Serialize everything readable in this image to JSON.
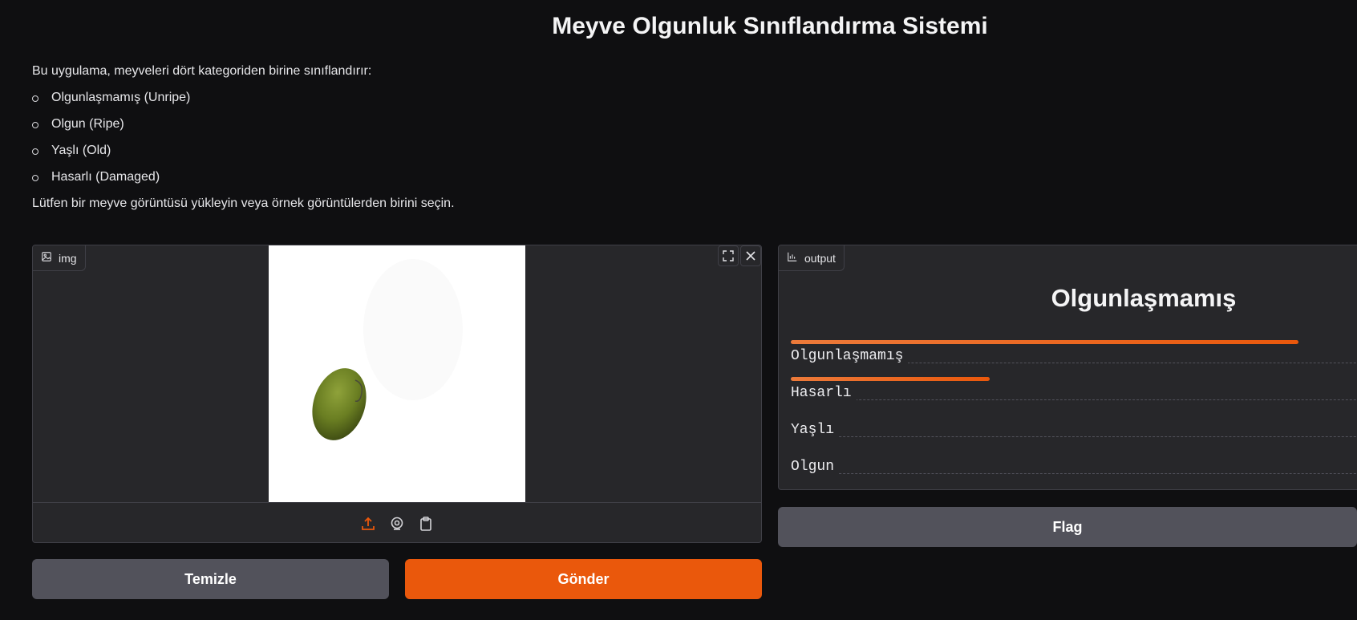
{
  "header": {
    "title": "Meyve Olgunluk Sınıflandırma Sistemi"
  },
  "description": {
    "intro": "Bu uygulama, meyveleri dört kategoriden birine sınıflandırır:",
    "items": [
      "Olgunlaşmamış (Unripe)",
      "Olgun (Ripe)",
      "Yaşlı (Old)",
      "Hasarlı (Damaged)"
    ],
    "note": "Lütfen bir meyve görüntüsü yükleyin veya örnek görüntülerden birini seçin."
  },
  "input_panel": {
    "label": "img",
    "icons": {
      "label": "image-icon",
      "fullscreen": "fullscreen-icon",
      "clear": "close-icon",
      "upload": "upload-icon",
      "webcam": "webcam-icon",
      "clipboard": "clipboard-icon"
    }
  },
  "output_panel": {
    "label": "output",
    "top_label": "Olgunlaşmamış",
    "confidences": [
      {
        "label": "Olgunlaşmamış",
        "value": 0.74
      },
      {
        "label": "Hasarlı",
        "value": 0.29
      },
      {
        "label": "Yaşlı",
        "value": 0.0
      },
      {
        "label": "Olgun",
        "value": 0.0
      }
    ]
  },
  "buttons": {
    "clear": "Temizle",
    "submit": "Gönder",
    "flag": "Flag"
  },
  "colors": {
    "background": "#0f0f11",
    "panel": "#27272a",
    "accent": "#ea580c",
    "secondary_button": "#52525b"
  }
}
